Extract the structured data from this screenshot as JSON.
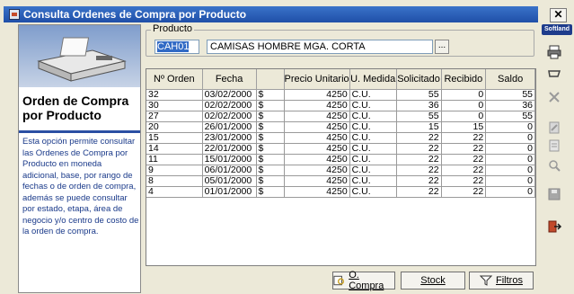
{
  "window": {
    "title": "Consulta Ordenes de Compra por Producto",
    "close_glyph": "✕",
    "brand_tag": "Softland"
  },
  "left_panel": {
    "title": "Orden de Compra por Producto",
    "description": "Esta opción permite consultar las Ordenes de Compra por Producto en moneda adicional, base, por rango de fechas o de orden de compra, además se puede consultar por estado, etapa, área de negocio y/o centro de costo de la orden de compra."
  },
  "product": {
    "group_label": "Producto",
    "code": "CAH01",
    "description": "CAMISAS HOMBRE MGA. CORTA",
    "browse_label": "..."
  },
  "grid": {
    "columns": [
      "Nº Orden",
      "Fecha",
      "",
      "Precio Unitario",
      "U. Medida",
      "Solicitado",
      "Recibido",
      "Saldo"
    ],
    "rows": [
      [
        "32",
        "03/02/2000",
        "$",
        "4250",
        "C.U.",
        "55",
        "0",
        "55"
      ],
      [
        "30",
        "02/02/2000",
        "$",
        "4250",
        "C.U.",
        "36",
        "0",
        "36"
      ],
      [
        "27",
        "02/02/2000",
        "$",
        "4250",
        "C.U.",
        "55",
        "0",
        "55"
      ],
      [
        "20",
        "26/01/2000",
        "$",
        "4250",
        "C.U.",
        "15",
        "15",
        "0"
      ],
      [
        "15",
        "23/01/2000",
        "$",
        "4250",
        "C.U.",
        "22",
        "22",
        "0"
      ],
      [
        "14",
        "22/01/2000",
        "$",
        "4250",
        "C.U.",
        "22",
        "22",
        "0"
      ],
      [
        "11",
        "15/01/2000",
        "$",
        "4250",
        "C.U.",
        "22",
        "22",
        "0"
      ],
      [
        "9",
        "06/01/2000",
        "$",
        "4250",
        "C.U.",
        "22",
        "22",
        "0"
      ],
      [
        "8",
        "05/01/2000",
        "$",
        "4250",
        "C.U.",
        "22",
        "22",
        "0"
      ],
      [
        "4",
        "01/01/2000",
        "$",
        "4250",
        "C.U.",
        "22",
        "22",
        "0"
      ]
    ]
  },
  "buttons": {
    "orden_compra": "O. Compra",
    "orden_compra_prefix": "",
    "stock": "Stock",
    "filtros": "Filtros"
  },
  "toolbar_icons": [
    "printer-icon",
    "undo-icon",
    "cancel-icon",
    "edit-icon",
    "document-icon",
    "search-icon",
    "save-icon",
    "exit-icon"
  ],
  "colors": {
    "titlebar": "#1f4fa8",
    "panel_divider": "#2b4fa3",
    "description_text": "#1a3a8a",
    "selection": "#316ac5"
  }
}
